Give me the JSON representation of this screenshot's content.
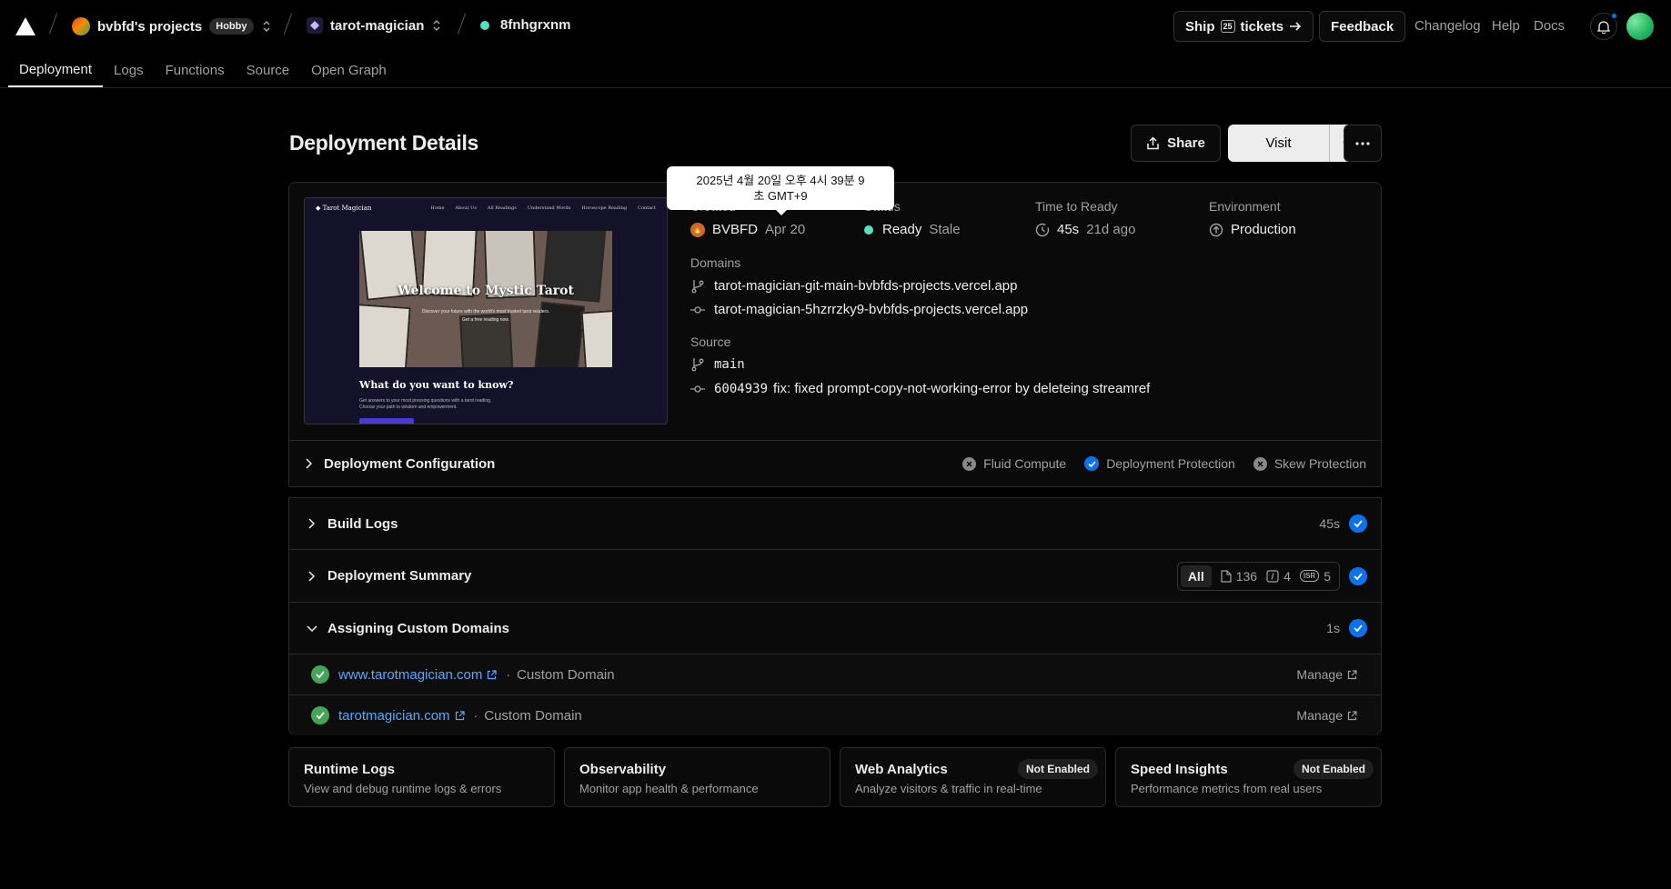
{
  "topbar": {
    "team_name": "bvbfd's projects",
    "plan_badge": "Hobby",
    "project_name": "tarot-magician",
    "deployment_id": "8fnhgrxnm",
    "ship_label": "Ship",
    "ship_number": "25",
    "tickets_label": "tickets",
    "feedback_label": "Feedback",
    "changelog_label": "Changelog",
    "help_label": "Help",
    "docs_label": "Docs"
  },
  "tabs": [
    {
      "label": "Deployment",
      "active": true
    },
    {
      "label": "Logs"
    },
    {
      "label": "Functions"
    },
    {
      "label": "Source"
    },
    {
      "label": "Open Graph"
    }
  ],
  "header": {
    "title": "Deployment Details",
    "share_label": "Share",
    "visit_label": "Visit"
  },
  "preview": {
    "site_name": "Tarot Magician",
    "nav_links": [
      "Home",
      "About Us",
      "All Readings",
      "Understand Words",
      "Horoscope Reading",
      "Contact"
    ],
    "hero_title": "Welcome to Mystic Tarot",
    "hero_sub1": "Discover your future with the world's most trusted tarot readers.",
    "hero_sub2": "Get a free reading now.",
    "question": "What do you want to know?",
    "text1": "Get answers to your most pressing questions with a tarot reading.",
    "text2": "Choose your path to wisdom and empowerment."
  },
  "tooltip": {
    "line1": "2025년 4월 20일 오후 4시 39분 9",
    "line2": "초 GMT+9"
  },
  "meta": {
    "created_label": "Created",
    "author": "BVBFD",
    "created_date": "Apr 20",
    "status_label": "Status",
    "status_value": "Ready",
    "status_sub": "Stale",
    "ttr_label": "Time to Ready",
    "ttr_value": "45s",
    "ttr_ago": "21d ago",
    "env_label": "Environment",
    "env_value": "Production",
    "domains_label": "Domains",
    "domains": [
      "tarot-magician-git-main-bvbfds-projects.vercel.app",
      "tarot-magician-5hzrrzky9-bvbfds-projects.vercel.app"
    ],
    "source_label": "Source",
    "branch": "main",
    "commit_sha": "6004939",
    "commit_msg": "fix: fixed prompt-copy-not-working-error by deleteing streamref"
  },
  "config": {
    "title": "Deployment Configuration",
    "features": [
      {
        "label": "Fluid Compute",
        "enabled": false
      },
      {
        "label": "Deployment Protection",
        "enabled": true
      },
      {
        "label": "Skew Protection",
        "enabled": false
      }
    ]
  },
  "build_logs": {
    "title": "Build Logs",
    "duration": "45s"
  },
  "summary": {
    "title": "Deployment Summary",
    "all_label": "All",
    "static_count": "136",
    "functions_count": "4",
    "isr_label": "ISR",
    "isr_count": "5"
  },
  "custom_domains": {
    "title": "Assigning Custom Domains",
    "duration": "1s",
    "items": [
      {
        "domain": "www.tarotmagician.com",
        "type": "Custom Domain",
        "action": "Manage"
      },
      {
        "domain": "tarotmagician.com",
        "type": "Custom Domain",
        "action": "Manage"
      }
    ],
    "separator": "·"
  },
  "bottom_cards": [
    {
      "title": "Runtime Logs",
      "desc": "View and debug runtime logs & errors",
      "badge": ""
    },
    {
      "title": "Observability",
      "desc": "Monitor app health & performance",
      "badge": ""
    },
    {
      "title": "Web Analytics",
      "desc": "Analyze visitors & traffic in real-time",
      "badge": "Not Enabled"
    },
    {
      "title": "Speed Insights",
      "desc": "Performance metrics from real users",
      "badge": "Not Enabled"
    }
  ],
  "colors": {
    "accent_blue": "#0a72ef",
    "ready_green": "#50e3c2",
    "link_blue": "#52a8ff",
    "check_green": "#45a557"
  }
}
